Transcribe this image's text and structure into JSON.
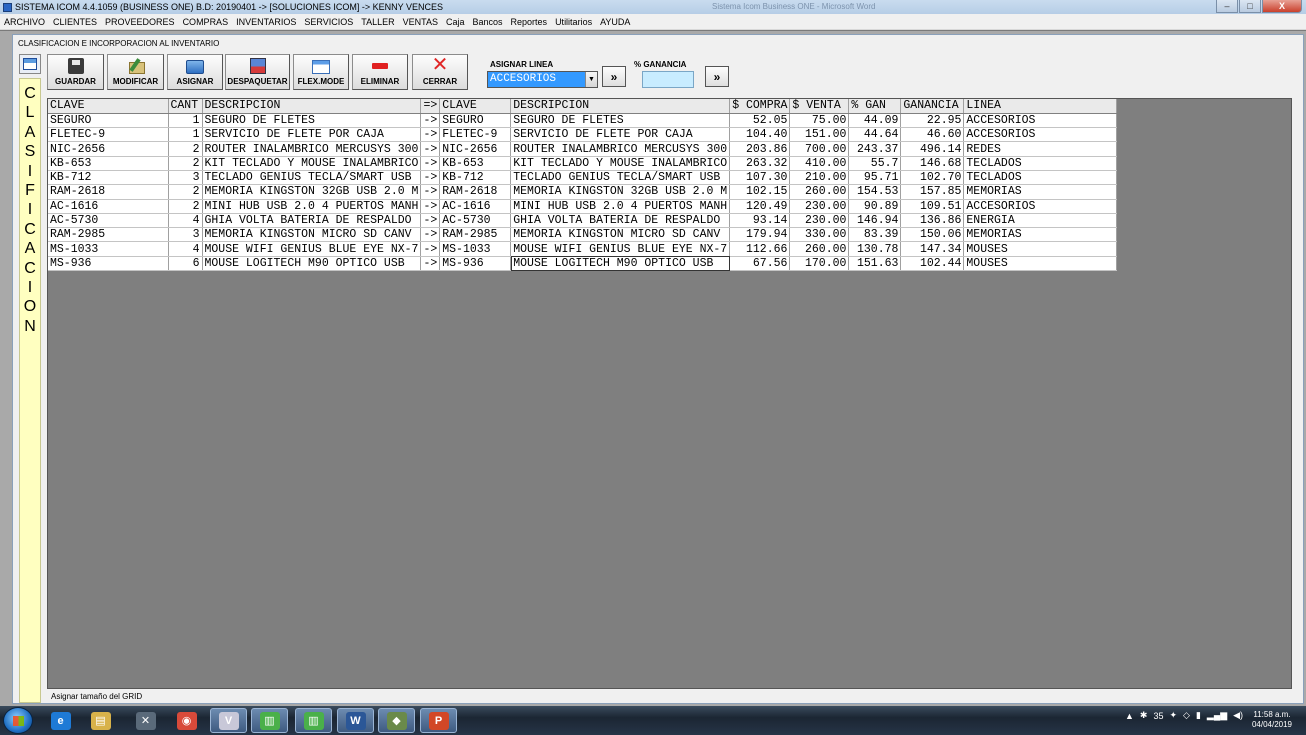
{
  "window": {
    "title": "SISTEMA ICOM 4.4.1059 (BUSINESS ONE)  B.D: 20190401  ->  [SOLUCIONES ICOM]  ->  KENNY VENCES",
    "ghost_title": "Sistema Icom Business ONE - Microsoft Word",
    "minimize": "–",
    "maximize": "□",
    "close": "X"
  },
  "menu": [
    "ARCHIVO",
    "CLIENTES",
    "PROVEEDORES",
    "COMPRAS",
    "INVENTARIOS",
    "SERVICIOS",
    "TALLER",
    "VENTAS",
    "Caja",
    "Bancos",
    "Reportes",
    "Utilitarios",
    "AYUDA"
  ],
  "child": {
    "title": "CLASIFICACION E INCORPORACION AL INVENTARIO",
    "sidebar_letters": [
      "C",
      "L",
      "A",
      "S",
      "I",
      "F",
      "I",
      "C",
      "A",
      "C",
      "I",
      "O",
      "N"
    ]
  },
  "toolbar": {
    "guardar": "GUARDAR",
    "modificar": "MODIFICAR",
    "asignar": "ASIGNAR",
    "despaquetar": "DESPAQUETAR",
    "flexmode": "FLEX.MODE",
    "eliminar": "ELIMINAR",
    "cerrar": "CERRAR",
    "asignar_linea_label": "ASIGNAR LINEA",
    "linea_value": "ACCESORIOS",
    "ganancia_label": "% GANANCIA",
    "go": "»"
  },
  "status": "Asignar tamaño del GRID",
  "grid": {
    "headers": [
      "CLAVE",
      "CANT",
      "DESCRIPCION",
      "=>",
      "CLAVE",
      "DESCRIPCION",
      "$ COMPRA",
      "$ VENTA",
      "% GAN",
      "GANANCIA",
      "LINEA"
    ],
    "rows": [
      [
        "SEGURO",
        "1",
        "SEGURO DE FLETES",
        "->",
        "SEGURO",
        "SEGURO DE FLETES",
        "52.05",
        "75.00",
        "44.09",
        "22.95",
        "ACCESORIOS"
      ],
      [
        "FLETEC-9",
        "1",
        "SERVICIO DE FLETE POR CAJA",
        "->",
        "FLETEC-9",
        "SERVICIO DE FLETE POR CAJA",
        "104.40",
        "151.00",
        "44.64",
        "46.60",
        "ACCESORIOS"
      ],
      [
        "NIC-2656",
        "2",
        "ROUTER INALAMBRICO MERCUSYS 300",
        "->",
        "NIC-2656",
        "ROUTER INALAMBRICO MERCUSYS 300",
        "203.86",
        "700.00",
        "243.37",
        "496.14",
        "REDES"
      ],
      [
        "KB-653",
        "2",
        "KIT TECLADO Y MOUSE INALAMBRICO",
        "->",
        "KB-653",
        "KIT TECLADO Y MOUSE INALAMBRICO",
        "263.32",
        "410.00",
        "55.7",
        "146.68",
        "TECLADOS"
      ],
      [
        "KB-712",
        "3",
        "TECLADO GENIUS TECLA/SMART USB",
        "->",
        "KB-712",
        "TECLADO GENIUS TECLA/SMART USB",
        "107.30",
        "210.00",
        "95.71",
        "102.70",
        "TECLADOS"
      ],
      [
        "RAM-2618",
        "2",
        "MEMORIA KINGSTON 32GB USB 2.0 M",
        "->",
        "RAM-2618",
        "MEMORIA KINGSTON 32GB USB 2.0 M",
        "102.15",
        "260.00",
        "154.53",
        "157.85",
        "MEMORIAS"
      ],
      [
        "AC-1616",
        "2",
        "MINI HUB USB 2.0 4 PUERTOS MANH",
        "->",
        "AC-1616",
        "MINI HUB USB 2.0 4 PUERTOS MANH",
        "120.49",
        "230.00",
        "90.89",
        "109.51",
        "ACCESORIOS"
      ],
      [
        "AC-5730",
        "4",
        "GHIA VOLTA BATERIA DE RESPALDO",
        "->",
        "AC-5730",
        "GHIA VOLTA BATERIA DE RESPALDO",
        "93.14",
        "230.00",
        "146.94",
        "136.86",
        "ENERGIA"
      ],
      [
        "RAM-2985",
        "3",
        "MEMORIA KINGSTON MICRO SD CANV",
        "->",
        "RAM-2985",
        "MEMORIA KINGSTON MICRO SD CANV",
        "179.94",
        "330.00",
        "83.39",
        "150.06",
        "MEMORIAS"
      ],
      [
        "MS-1033",
        "4",
        "MOUSE WIFI GENIUS BLUE EYE NX-7",
        "->",
        "MS-1033",
        "MOUSE WIFI GENIUS BLUE EYE NX-7",
        "112.66",
        "260.00",
        "130.78",
        "147.34",
        "MOUSES"
      ],
      [
        "MS-936",
        "6",
        "MOUSE LOGITECH M90 OPTICO USB",
        "->",
        "MS-936",
        "MOUSE LOGITECH M90 OPTICO USB",
        "67.56",
        "170.00",
        "151.63",
        "102.44",
        "MOUSES"
      ]
    ]
  },
  "taskbar": {
    "apps": [
      {
        "name": "ie",
        "glyph": "e",
        "color": "#1e7ad6"
      },
      {
        "name": "explorer",
        "glyph": "▤",
        "color": "#d8b24a"
      },
      {
        "name": "tools",
        "glyph": "✕",
        "color": "#5a6a7a"
      },
      {
        "name": "chrome",
        "glyph": "◉",
        "color": "#d84a3a"
      },
      {
        "name": "vnc",
        "glyph": "V",
        "color": "#c8c8d8"
      },
      {
        "name": "icom-1",
        "glyph": "▥",
        "color": "#4ab04a"
      },
      {
        "name": "icom-2",
        "glyph": "▥",
        "color": "#4ab04a"
      },
      {
        "name": "word",
        "glyph": "W",
        "color": "#2b5797"
      },
      {
        "name": "app",
        "glyph": "◆",
        "color": "#6a8a4a"
      },
      {
        "name": "powerpoint",
        "glyph": "P",
        "color": "#d24726"
      }
    ],
    "tray_count": "35",
    "time": "11:58 a.m.",
    "date": "04/04/2019"
  }
}
